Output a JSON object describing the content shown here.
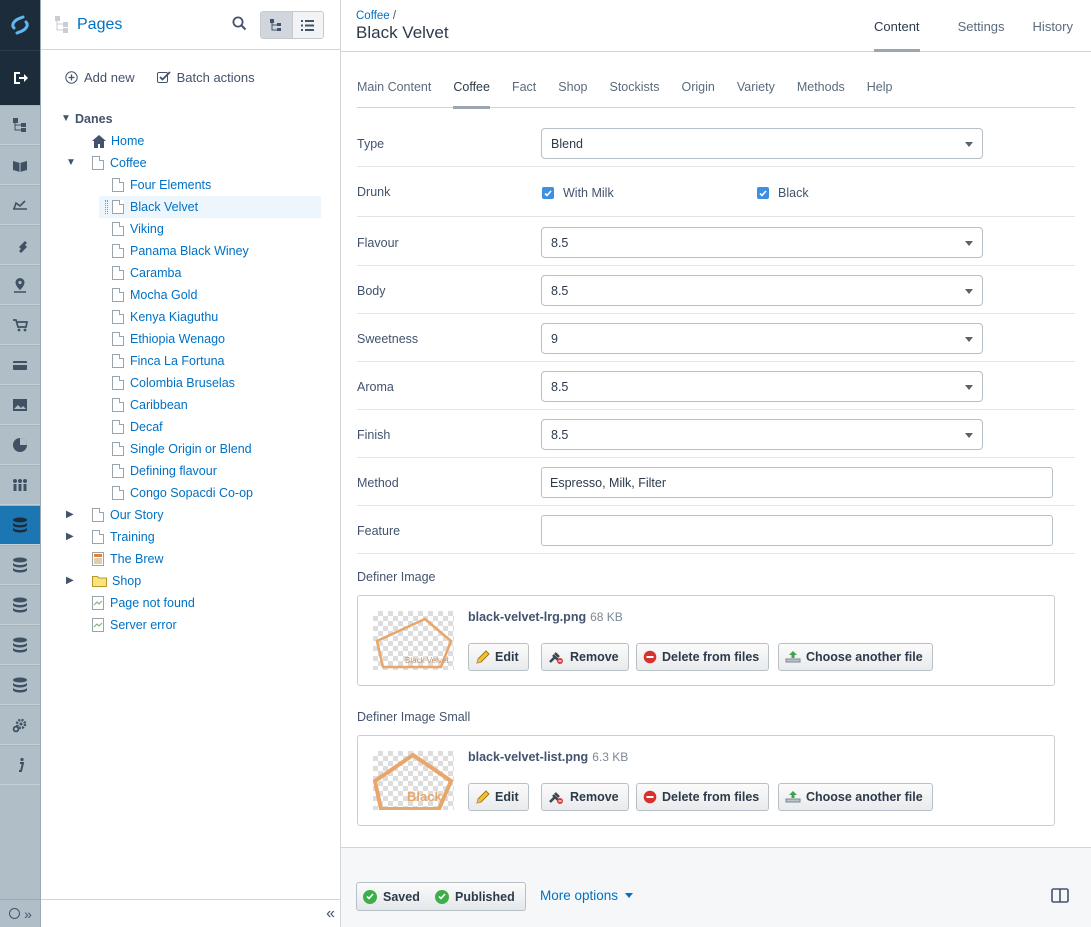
{
  "app": {
    "accent": "#0071c4",
    "rail_active": "#1b76b3"
  },
  "rail": {
    "items": [
      "pages-icon",
      "book-icon",
      "reports-icon",
      "ticket-icon",
      "map-pin-icon",
      "cart-icon",
      "payment-card-icon",
      "image-icon",
      "pie-chart-icon",
      "people-icon",
      "database-icon",
      "database-icon",
      "database-icon",
      "database-icon",
      "database-icon",
      "gear-icon",
      "info-icon"
    ],
    "active_index": 10
  },
  "tree": {
    "title": "Pages",
    "add_new": "Add new",
    "batch_actions": "Batch actions",
    "root": "Danes",
    "nodes": [
      {
        "label": "Home",
        "icon": "home-icon",
        "level": 1
      },
      {
        "label": "Coffee",
        "icon": "page-icon",
        "level": 1,
        "expanded": true
      },
      {
        "label": "Four Elements",
        "icon": "page-icon",
        "level": 2
      },
      {
        "label": "Black Velvet",
        "icon": "page-icon",
        "level": 2,
        "selected": true
      },
      {
        "label": "Viking",
        "icon": "page-icon",
        "level": 2
      },
      {
        "label": "Panama Black Winey",
        "icon": "page-icon",
        "level": 2
      },
      {
        "label": "Caramba",
        "icon": "page-icon",
        "level": 2
      },
      {
        "label": "Mocha Gold",
        "icon": "page-icon",
        "level": 2
      },
      {
        "label": "Kenya Kiaguthu",
        "icon": "page-icon",
        "level": 2
      },
      {
        "label": "Ethiopia Wenago",
        "icon": "page-icon",
        "level": 2
      },
      {
        "label": "Finca La Fortuna",
        "icon": "page-icon",
        "level": 2
      },
      {
        "label": "Colombia Bruselas",
        "icon": "page-icon",
        "level": 2
      },
      {
        "label": "Caribbean",
        "icon": "page-icon",
        "level": 2
      },
      {
        "label": "Decaf",
        "icon": "page-icon",
        "level": 2
      },
      {
        "label": "Single Origin or Blend",
        "icon": "page-icon",
        "level": 2
      },
      {
        "label": "Defining flavour",
        "icon": "page-icon",
        "level": 2
      },
      {
        "label": "Congo Sopacdi Co-op",
        "icon": "page-icon",
        "level": 2
      },
      {
        "label": "Our Story",
        "icon": "page-icon",
        "level": 1,
        "collapsed": true
      },
      {
        "label": "Training",
        "icon": "page-icon",
        "level": 1,
        "collapsed": true
      },
      {
        "label": "The Brew",
        "icon": "calendar-page-icon",
        "level": 1
      },
      {
        "label": "Shop",
        "icon": "folder-icon",
        "level": 1,
        "collapsed": true
      },
      {
        "label": "Page not found",
        "icon": "error-page-icon",
        "level": 1
      },
      {
        "label": "Server error",
        "icon": "error-page-icon",
        "level": 1
      }
    ]
  },
  "header": {
    "breadcrumb": "Coffee",
    "breadcrumb_sep": "/",
    "title": "Black Velvet",
    "tabs": [
      "Content",
      "Settings",
      "History"
    ]
  },
  "subtabs": [
    "Main Content",
    "Coffee",
    "Fact",
    "Shop",
    "Stockists",
    "Origin",
    "Variety",
    "Methods",
    "Help"
  ],
  "form": {
    "type_label": "Type",
    "type_value": "Blend",
    "drunk_label": "Drunk",
    "drunk_opt1": "With Milk",
    "drunk_opt2": "Black",
    "flavour_label": "Flavour",
    "flavour_value": "8.5",
    "body_label": "Body",
    "body_value": "8.5",
    "sweetness_label": "Sweetness",
    "sweetness_value": "9",
    "aroma_label": "Aroma",
    "aroma_value": "8.5",
    "finish_label": "Finish",
    "finish_value": "8.5",
    "method_label": "Method",
    "method_value": "Espresso, Milk, Filter",
    "feature_label": "Feature",
    "feature_value": ""
  },
  "files": [
    {
      "label": "Definer Image",
      "name": "black-velvet-lrg.png",
      "size": "68 KB",
      "thumb_text": "Black Velvet"
    },
    {
      "label": "Definer Image Small",
      "name": "black-velvet-list.png",
      "size": "6.3 KB",
      "thumb_text": "Black"
    }
  ],
  "file_buttons": {
    "edit": "Edit",
    "remove": "Remove",
    "delete": "Delete from files",
    "choose": "Choose another file"
  },
  "footer": {
    "saved": "Saved",
    "published": "Published",
    "more": "More options"
  }
}
